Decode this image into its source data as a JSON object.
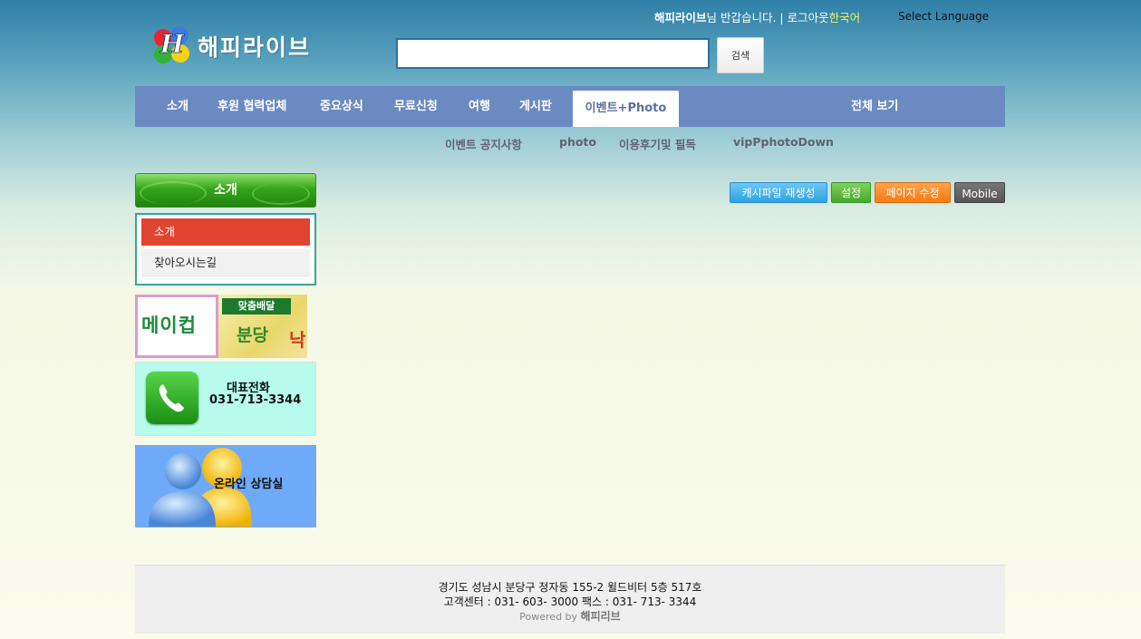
{
  "header": {
    "logo_text": "해피라이브",
    "user_name": "해피라이브",
    "greeting_suffix": "님 반갑습니다. | ",
    "logout_label": "로그아웃",
    "language_current": "한국어",
    "select_language": "Select Language"
  },
  "search": {
    "value": "",
    "placeholder": "",
    "button_label": "검색"
  },
  "nav": {
    "items": [
      {
        "label": "소개"
      },
      {
        "label": "후원 협력업체"
      },
      {
        "label": "중요상식"
      },
      {
        "label": "무료신청"
      },
      {
        "label": "여행"
      },
      {
        "label": "게시판"
      },
      {
        "label": "이벤트+Photo",
        "active": true
      },
      {
        "label": "전체 보기"
      }
    ],
    "sub_items": [
      {
        "label": "이벤트 공지사항"
      },
      {
        "label": "photo"
      },
      {
        "label": "이용후기및 필독"
      },
      {
        "label": "vipPphotoDown"
      }
    ]
  },
  "sidebar": {
    "title": "소개",
    "items": [
      {
        "label": "소개",
        "active": true
      },
      {
        "label": "찾아오시는길",
        "active": false
      }
    ]
  },
  "banners": {
    "makeup": {
      "text": "메이컵",
      "tag": "맞춤배달",
      "branch": "분당",
      "extra": "낙"
    },
    "phone": {
      "title": "대표전화",
      "number": "031-713-3344"
    },
    "consult": {
      "label": "온라인 상담실"
    }
  },
  "admin_buttons": {
    "cache": "캐시파일 재생성",
    "settings": "설정",
    "edit_page": "페이지 수정",
    "mobile": "Mobile"
  },
  "footer": {
    "address": "경기도 성남시 분당구 정자동 155-2 윌드비터 5층 517호",
    "contact": "고객센터 : 031- 603- 3000 팩스 : 031- 713- 3344",
    "powered_by": "Powered by",
    "powered_brand": "해피리브"
  },
  "colors": {
    "nav_bg": "#6c8ac2",
    "sidebar_active": "#e04531",
    "sidebar_header": "#37a51a",
    "phone_banner_bg": "#b6fbec",
    "consult_banner_bg": "#6eaaf8"
  }
}
